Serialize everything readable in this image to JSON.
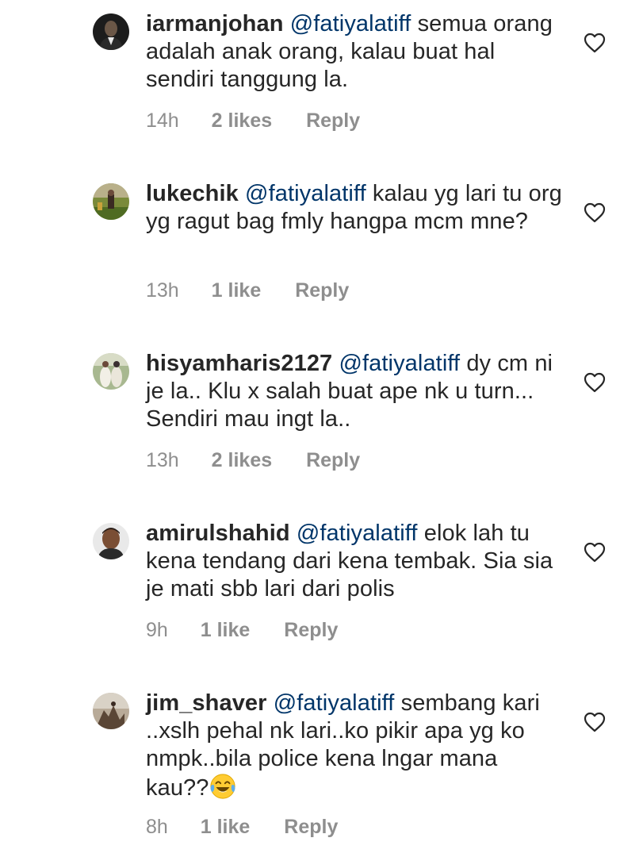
{
  "comments": [
    {
      "username": "iarmanjohan",
      "mention": "@fatiyalatiff",
      "text": " semua orang adalah anak orang, kalau buat hal sendiri tanggung la.",
      "time": "14h",
      "likes": "2 likes",
      "reply": "Reply"
    },
    {
      "username": "lukechik",
      "mention": "@fatiyalatiff",
      "text": " kalau yg lari tu org yg ragut bag fmly hangpa mcm mne?",
      "time": "13h",
      "likes": "1 like",
      "reply": "Reply"
    },
    {
      "username": "hisyamharis2127",
      "mention": "@fatiyalatiff",
      "text": " dy cm ni je la.. Klu x salah buat ape nk u turn... Sendiri mau ingt la..",
      "time": "13h",
      "likes": "2 likes",
      "reply": "Reply"
    },
    {
      "username": "amirulshahid",
      "mention": "@fatiyalatiff",
      "text": " elok lah tu kena tendang dari kena tembak. Sia sia je mati sbb lari dari polis",
      "time": "9h",
      "likes": "1 like",
      "reply": "Reply"
    },
    {
      "username": "jim_shaver",
      "mention": "@fatiyalatiff",
      "text": " sembang kari ..xslh pehal nk lari..ko pikir apa yg ko nmpk..bila police kena lngar mana kau??",
      "emoji": "face-with-tears-of-joy-emoji",
      "time": "8h",
      "likes": "1 like",
      "reply": "Reply"
    }
  ],
  "icons": {
    "like": "heart-outline-icon"
  },
  "colors": {
    "text": "#262626",
    "mention": "#003569",
    "meta": "#8e8e8e",
    "background": "#ffffff"
  }
}
